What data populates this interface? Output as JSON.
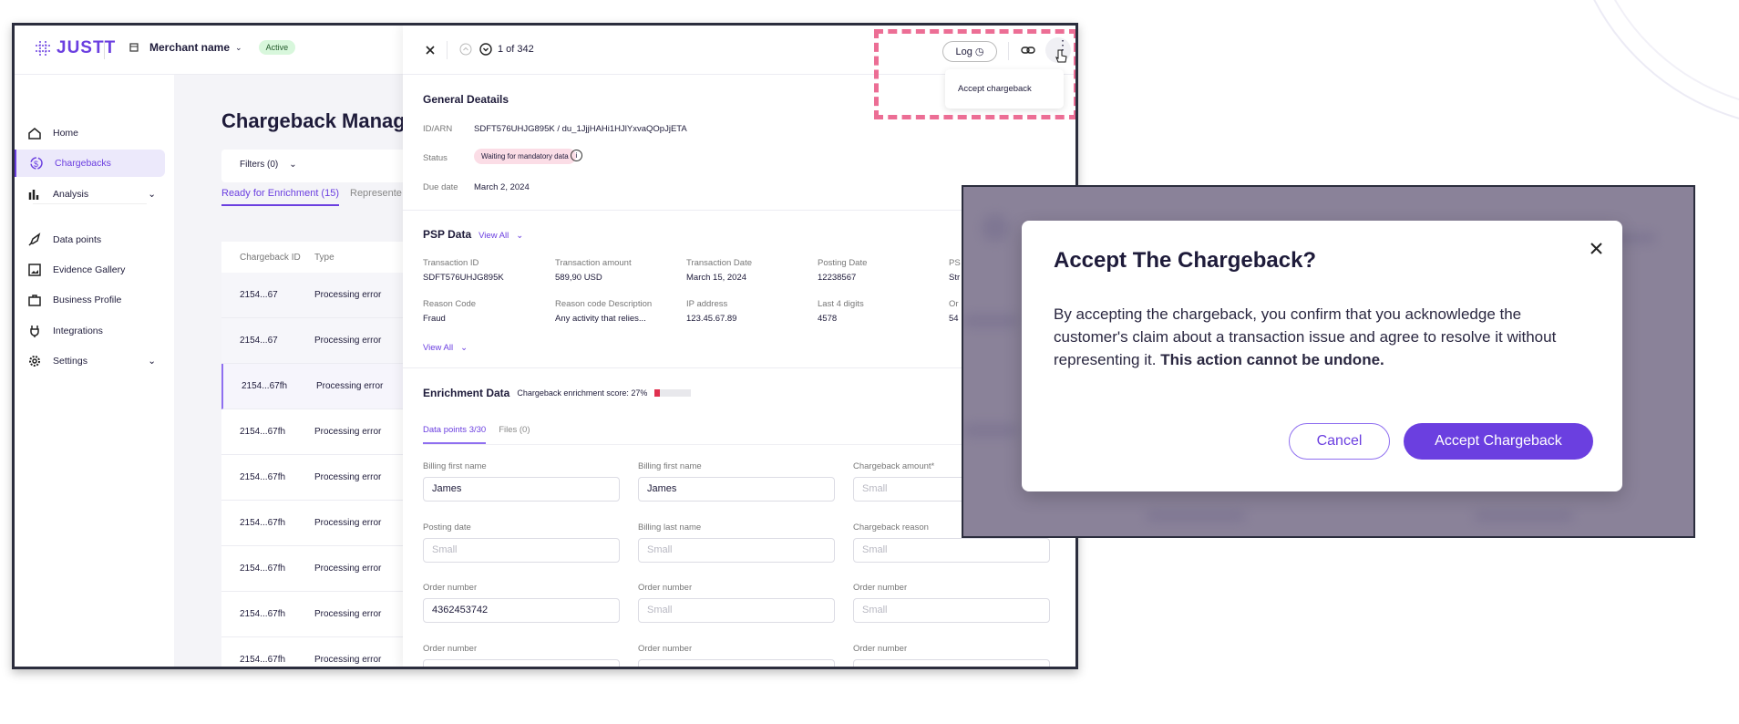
{
  "header": {
    "logo": "JUSTT",
    "merchant": "Merchant name",
    "status": "Active"
  },
  "sidebar": {
    "items": [
      {
        "label": "Home",
        "icon": "home-icon"
      },
      {
        "label": "Chargebacks",
        "icon": "chargeback-icon",
        "active": true
      },
      {
        "label": "Analysis",
        "icon": "bar-chart-icon",
        "expandable": true
      },
      {
        "label": "Data points",
        "icon": "rocket-icon"
      },
      {
        "label": "Evidence Gallery",
        "icon": "image-icon"
      },
      {
        "label": "Business Profile",
        "icon": "briefcase-icon"
      },
      {
        "label": "Integrations",
        "icon": "plug-icon"
      },
      {
        "label": "Settings",
        "icon": "gear-icon",
        "expandable": true
      }
    ]
  },
  "main": {
    "title": "Chargeback Manage",
    "filters": "Filters (0)",
    "tabs": [
      "Ready for Enrichment (15)",
      "Represente"
    ],
    "table": {
      "headers": [
        "Chargeback ID",
        "Type"
      ],
      "rows": [
        [
          "2154...67",
          "Processing error"
        ],
        [
          "2154...67",
          "Processing error"
        ],
        [
          "2154...67fh",
          "Processing error"
        ],
        [
          "2154...67fh",
          "Processing error"
        ],
        [
          "2154...67fh",
          "Processing error"
        ],
        [
          "2154...67fh",
          "Processing error"
        ],
        [
          "2154...67fh",
          "Processing error"
        ],
        [
          "2154...67fh",
          "Processing error"
        ],
        [
          "2154...67fh",
          "Processing error"
        ]
      ]
    }
  },
  "drawer": {
    "pager": "1 of 342",
    "log": "Log",
    "menu_item": "Accept chargeback",
    "general": {
      "title": "General Deatails",
      "rows": [
        [
          "ID/ARN",
          "SDFT576UHJG895K / du_1JjjHAHi1HJlYxvaQOpJjETA"
        ],
        [
          "Status",
          "Waiting for mandatory data"
        ],
        [
          "Due date",
          "March 2, 2024"
        ]
      ]
    },
    "psp": {
      "title": "PSP Data",
      "view_all": "View All",
      "fields": [
        [
          "Transaction ID",
          "SDFT576UHJG895K"
        ],
        [
          "Transaction amount",
          "589,90 USD"
        ],
        [
          "Transaction Date",
          "March 15, 2024"
        ],
        [
          "Posting Date",
          "12238567"
        ],
        [
          "PS",
          "Str"
        ],
        [
          "Reason Code",
          "Fraud"
        ],
        [
          "Reason code Description",
          "Any activity that relies..."
        ],
        [
          "IP address",
          "123.45.67.89"
        ],
        [
          "Last 4 digits",
          "4578"
        ],
        [
          "Or",
          "54"
        ]
      ]
    },
    "enrichment": {
      "title": "Enrichment Data",
      "score_label": "Chargeback enrichment score: 27%",
      "score": 27,
      "tabs": [
        "Data points 3/30",
        "Files (0)"
      ],
      "fields": [
        {
          "label": "Billing first name",
          "value": "James"
        },
        {
          "label": "Billing first name",
          "value": "James"
        },
        {
          "label": "Chargeback amount*",
          "placeholder": "Small"
        },
        {
          "label": "Posting date",
          "placeholder": "Small"
        },
        {
          "label": "Billing last name",
          "placeholder": "Small"
        },
        {
          "label": "Chargeback reason",
          "placeholder": "Small"
        },
        {
          "label": "Order number",
          "value": "4362453742"
        },
        {
          "label": "Order number",
          "placeholder": "Small"
        },
        {
          "label": "Order number",
          "placeholder": "Small"
        },
        {
          "label": "Order number",
          "placeholder": ""
        },
        {
          "label": "Order number",
          "placeholder": ""
        },
        {
          "label": "Order number",
          "placeholder": ""
        }
      ]
    }
  },
  "dialog": {
    "title": "Accept The Chargeback?",
    "body": "By accepting the chargeback, you confirm that you acknowledge the customer's claim about a transaction issue and agree to resolve it without representing it. ",
    "body_bold": "This action cannot be undone.",
    "cancel": "Cancel",
    "confirm": "Accept Chargeback"
  },
  "colors": {
    "accent": "#6b3fe0",
    "highlight": "#ec6e95",
    "status_pink": "#fbdde6",
    "active_green": "#d8f7dc"
  }
}
